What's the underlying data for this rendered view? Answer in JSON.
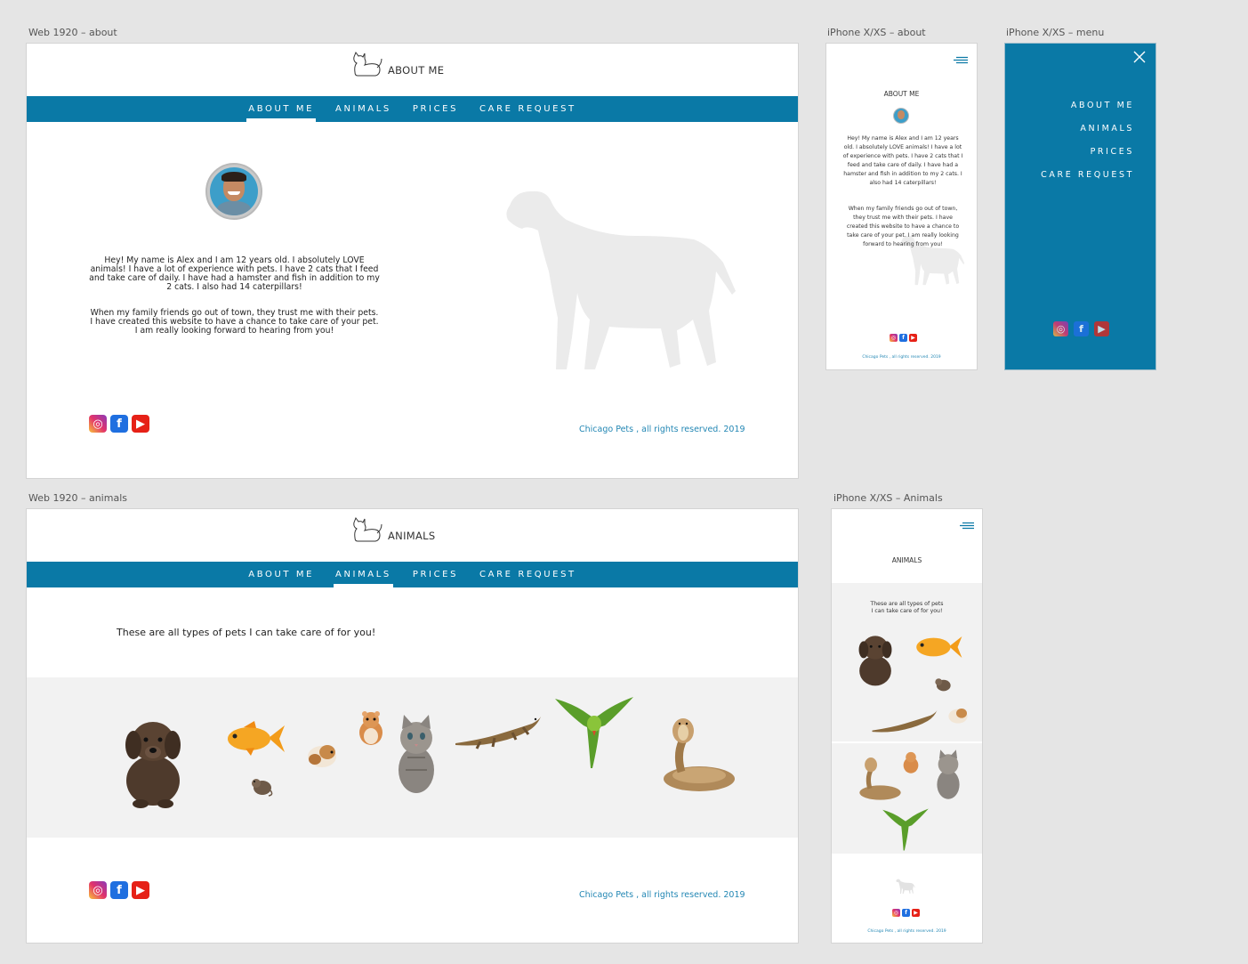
{
  "artboard_labels": {
    "web_about": "Web 1920 – about",
    "iphone_about": "iPhone X/XS – about",
    "iphone_menu": "iPhone X/XS – menu",
    "web_animals": "Web 1920 – animals",
    "iphone_animals": "iPhone X/XS – Animals"
  },
  "nav": {
    "items": [
      "ABOUT ME",
      "ANIMALS",
      "PRICES",
      "CARE REQUEST"
    ]
  },
  "about": {
    "title": "ABOUT ME",
    "paragraph1": "Hey! My name is Alex and I am 12 years old. I absolutely LOVE animals! I have a lot of experience with pets. I have 2 cats that I feed and take care of daily. I have had a hamster and fish in addition to my 2 cats. I also had 14 caterpillars!",
    "paragraph2": "When my family friends go out of town, they trust me with their pets. I have created this website to have a chance to take care of your pet. I am really looking forward to hearing from you!"
  },
  "animals": {
    "title": "ANIMALS",
    "intro": "These are all types of pets I can take care of for you!",
    "intro_mobile_line1": "These are all types of pets",
    "intro_mobile_line2": "I can take care of for you!"
  },
  "footer": {
    "copyright": "Chicago Pets , all rights reserved.   2019"
  },
  "icons": {
    "instagram": "instagram-icon",
    "facebook": "facebook-icon",
    "youtube": "youtube-icon",
    "menu": "hamburger-menu-icon",
    "close": "close-icon"
  },
  "colors": {
    "nav_blue": "#0a79a6",
    "footer_text": "#2387b4",
    "strip_gray": "#f2f2f2"
  }
}
